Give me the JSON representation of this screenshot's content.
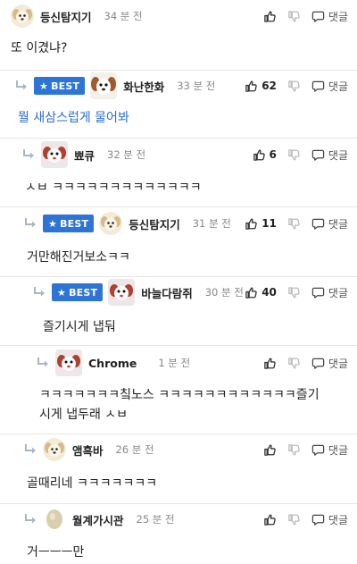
{
  "comments": [
    {
      "nick": "등신탐지기",
      "time": "34 분 전",
      "text": "또 이겼냐?",
      "likes": "",
      "best": false,
      "reply_label": "댓글"
    },
    {
      "nick": "화난한화",
      "time": "33 분 전",
      "text": "뭘 새삼스럽게 물어봐",
      "likes": "62",
      "best": true,
      "reply_label": "댓글"
    },
    {
      "nick": "뾰큐",
      "time": "32 분 전",
      "text": "ㅅㅂ ㅋㅋㅋㅋㅋㅋㅋㅋㅋㅋㅋㅋㅋ",
      "likes": "6",
      "best": false,
      "reply_label": "댓글"
    },
    {
      "nick": "등신탐지기",
      "time": "31 분 전",
      "text": "거만해진거보소ㅋㅋ",
      "likes": "11",
      "best": true,
      "reply_label": "댓글"
    },
    {
      "nick": "바늘다람쥐",
      "time": "30 분 전",
      "text": "즐기시게 냅둬",
      "likes": "40",
      "best": true,
      "reply_label": "댓글"
    },
    {
      "nick": "Chrome",
      "time": "1 분 전",
      "text_line1": "ㅋㅋㅋㅋㅋㅋㅋ칰노스 ㅋㅋㅋㅋㅋㅋㅋㅋㅋㅋㅋㅋ즐기",
      "text_line2": "시게 냅두래 ㅅㅂ",
      "likes": "",
      "best": false,
      "reply_label": "댓글"
    },
    {
      "nick": "앰흑바",
      "time": "26 분 전",
      "text": "골때리네 ㅋㅋㅋㅋㅋㅋㅋ",
      "likes": "",
      "best": false,
      "reply_label": "댓글"
    },
    {
      "nick": "월계가시관",
      "time": "25 분 전",
      "text": "거ㅡㅡㅡ만",
      "likes": "",
      "best": false,
      "reply_label": "댓글"
    }
  ],
  "best_label": "BEST",
  "best_star": "★",
  "colors": {
    "best_badge": "#2d74d6",
    "blue_text": "#2a6fd6",
    "divider": "#e6e6e6"
  },
  "icons": [
    "thumbs-up-icon",
    "thumbs-down-icon",
    "comment-bubble-icon",
    "reply-arrow-icon",
    "dog-avatar"
  ]
}
